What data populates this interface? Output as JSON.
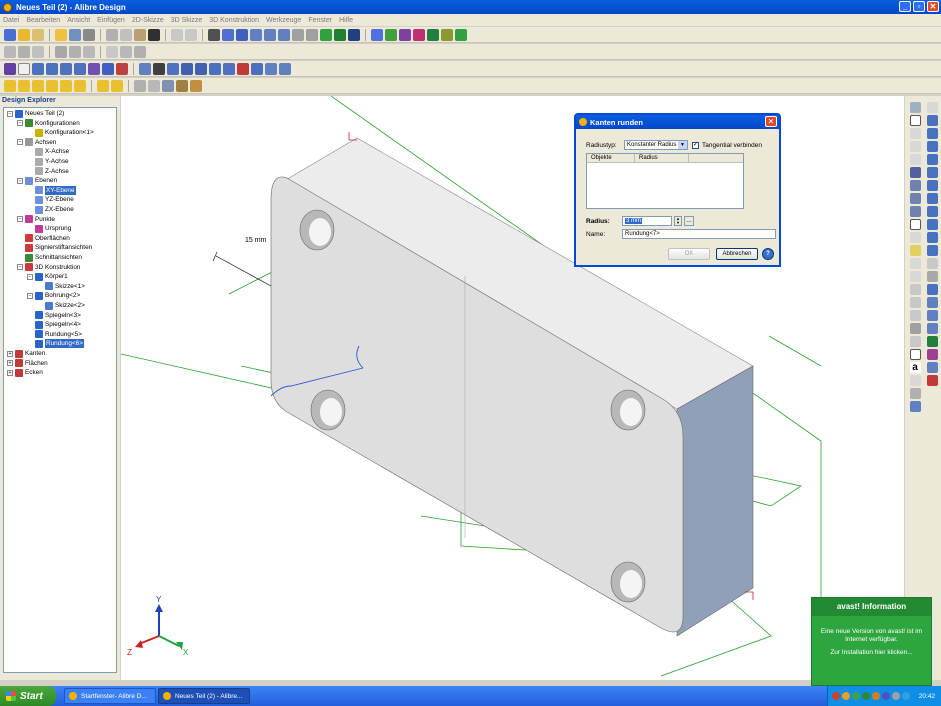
{
  "window": {
    "title": "Neues Teil (2) - Alibre Design",
    "controls": [
      "_",
      "▫",
      "✕"
    ]
  },
  "menu": [
    "Datei",
    "Bearbeiten",
    "Ansicht",
    "Einfügen",
    "2D-Skizze",
    "3D Skizze",
    "3D Konstruktion",
    "Werkzeuge",
    "Fenster",
    "Hilfe"
  ],
  "explorer": {
    "title": "Design Explorer",
    "tree": [
      {
        "label": "Neues Teil (2)",
        "depth": 0,
        "exp": "-",
        "icon": "part-icon",
        "color": "#2a63c9"
      },
      {
        "label": "Konfigurationen",
        "depth": 1,
        "exp": "-",
        "icon": "config-icon",
        "color": "#3c8a2e"
      },
      {
        "label": "Konfiguration<1>",
        "depth": 2,
        "exp": "",
        "icon": "config-item-icon",
        "color": "#c8b400"
      },
      {
        "label": "Achsen",
        "depth": 1,
        "exp": "-",
        "icon": "axis-icon",
        "color": "#999999"
      },
      {
        "label": "X-Achse",
        "depth": 2,
        "exp": "",
        "icon": "axis-icon",
        "color": "#aaaaaa"
      },
      {
        "label": "Y-Achse",
        "depth": 2,
        "exp": "",
        "icon": "axis-icon",
        "color": "#aaaaaa"
      },
      {
        "label": "Z-Achse",
        "depth": 2,
        "exp": "",
        "icon": "axis-icon",
        "color": "#aaaaaa"
      },
      {
        "label": "Ebenen",
        "depth": 1,
        "exp": "-",
        "icon": "plane-icon",
        "color": "#6b8fd8"
      },
      {
        "label": "XY-Ebene",
        "depth": 2,
        "exp": "",
        "icon": "plane-icon",
        "color": "#6b8fd8",
        "selected": true
      },
      {
        "label": "YZ-Ebene",
        "depth": 2,
        "exp": "",
        "icon": "plane-icon",
        "color": "#6b8fd8"
      },
      {
        "label": "ZX-Ebene",
        "depth": 2,
        "exp": "",
        "icon": "plane-icon",
        "color": "#6b8fd8"
      },
      {
        "label": "Punkte",
        "depth": 1,
        "exp": "-",
        "icon": "point-icon",
        "color": "#c03a9a"
      },
      {
        "label": "Ursprung",
        "depth": 2,
        "exp": "",
        "icon": "origin-icon",
        "color": "#c03a9a"
      },
      {
        "label": "Oberflächen",
        "depth": 1,
        "exp": "",
        "icon": "surface-icon",
        "color": "#cc3a3a"
      },
      {
        "label": "Signierstiftansichten",
        "depth": 1,
        "exp": "",
        "icon": "markup-icon",
        "color": "#cc3a3a"
      },
      {
        "label": "Schnittansichten",
        "depth": 1,
        "exp": "",
        "icon": "section-icon",
        "color": "#3a8a3a"
      },
      {
        "label": "3D Konstruktion",
        "depth": 1,
        "exp": "-",
        "icon": "design-icon",
        "color": "#cc3a3a"
      },
      {
        "label": "Körper1",
        "depth": 2,
        "exp": "-",
        "icon": "body-icon",
        "color": "#2a63c9"
      },
      {
        "label": "Skizze<1>",
        "depth": 3,
        "exp": "",
        "icon": "sketch-icon",
        "color": "#4a7ad0"
      },
      {
        "label": "Bohrung<2>",
        "depth": 2,
        "exp": "-",
        "icon": "hole-icon",
        "color": "#2a63c9"
      },
      {
        "label": "Skizze<2>",
        "depth": 3,
        "exp": "",
        "icon": "sketch-icon",
        "color": "#4a7ad0"
      },
      {
        "label": "Spiegeln<3>",
        "depth": 2,
        "exp": "",
        "icon": "mirror-icon",
        "color": "#2a63c9"
      },
      {
        "label": "Spiegeln<4>",
        "depth": 2,
        "exp": "",
        "icon": "mirror-icon",
        "color": "#2a63c9"
      },
      {
        "label": "Rundung<5>",
        "depth": 2,
        "exp": "",
        "icon": "fillet-icon",
        "color": "#2a63c9"
      },
      {
        "label": "Rundung<6>",
        "depth": 2,
        "exp": "",
        "icon": "fillet-icon",
        "color": "#2a63c9",
        "selected": true
      },
      {
        "label": "Kanten",
        "depth": 0,
        "exp": "+",
        "icon": "edges-icon",
        "color": "#c03a3a"
      },
      {
        "label": "Flächen",
        "depth": 0,
        "exp": "+",
        "icon": "faces-icon",
        "color": "#c03a3a"
      },
      {
        "label": "Ecken",
        "depth": 0,
        "exp": "+",
        "icon": "vertices-icon",
        "color": "#c03a3a"
      }
    ]
  },
  "viewport": {
    "dimension_label": "15 mm",
    "triad": {
      "x": "X",
      "y": "Y",
      "z": "Z"
    },
    "colors": {
      "body_top": "#e8e8e8",
      "body_front": "#dcdcdc",
      "body_side": "#8fa0b8",
      "plane_green": "#2aa02a",
      "sketch_blue": "#2a5ad0",
      "accent_red": "#cc2222"
    }
  },
  "dialog": {
    "title": "Kanten runden",
    "radius_type_label": "Radiustyp:",
    "radius_type_value": "Konstanter Radius",
    "tangential_label": "Tangential verbinden",
    "tangential_checked": "✓",
    "columns": [
      "Objekte",
      "Radius"
    ],
    "radius_label": "Radius:",
    "radius_value": "3 mm",
    "name_label": "Name:",
    "name_value": "Rundung<7>",
    "ok": "OK",
    "cancel": "Abbrechen",
    "help": "?"
  },
  "avast": {
    "title": "avast! Information",
    "line1": "Eine neue Version von avast! ist im Internet verfügbar.",
    "line2": "Zur Installation hier klicken..."
  },
  "taskbar": {
    "start": "Start",
    "tasks": [
      "Startfenster- Alibre D...",
      "Neues Teil (2) - Alibre..."
    ],
    "clock": "20:42"
  }
}
